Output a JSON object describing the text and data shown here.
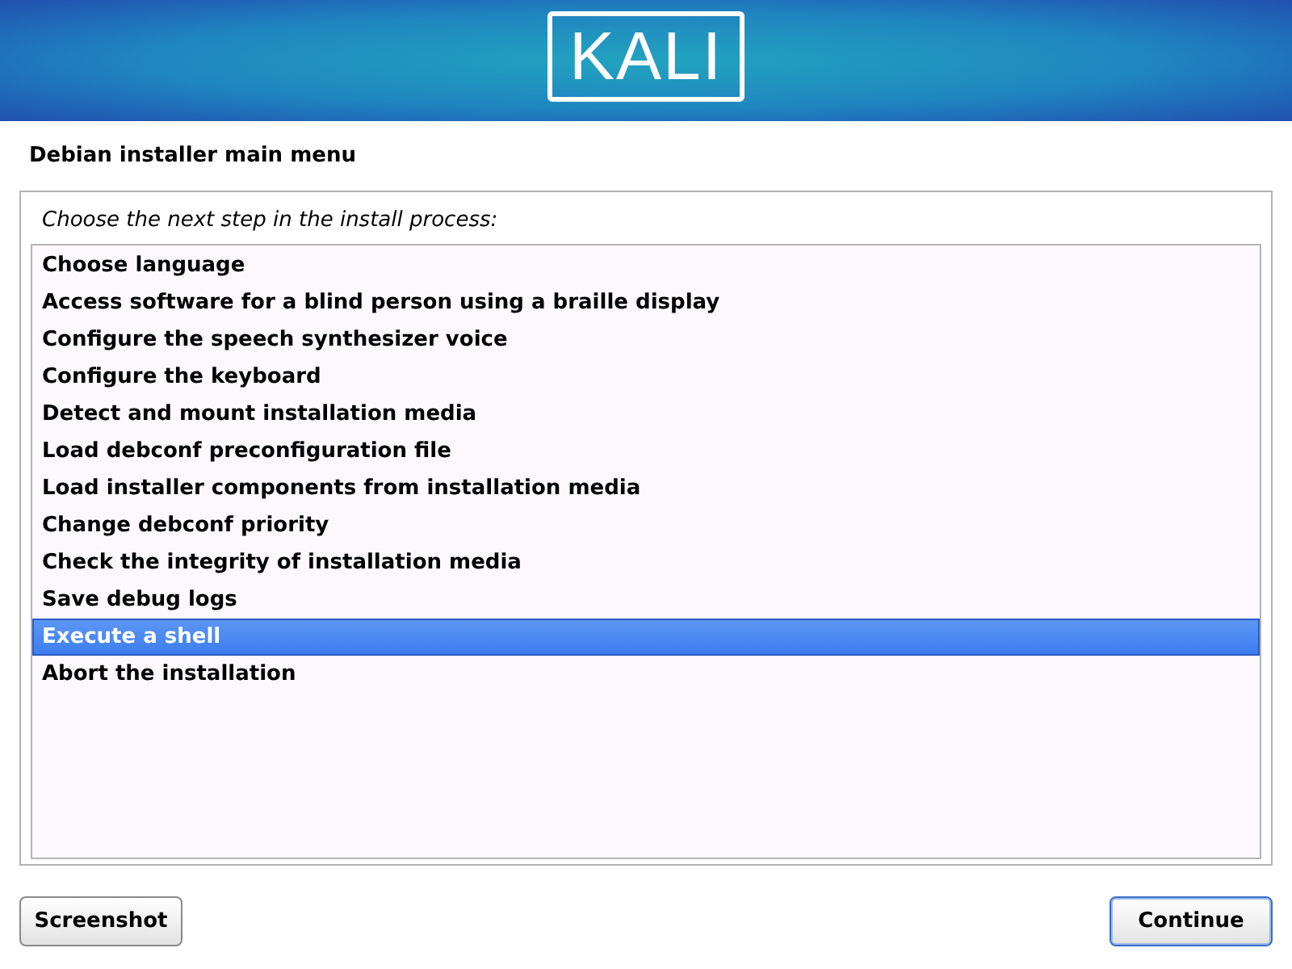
{
  "banner": {
    "logo": "KALI"
  },
  "title": "Debian installer main menu",
  "prompt": "Choose the next step in the install process:",
  "items": [
    {
      "label": "Choose language",
      "selected": false
    },
    {
      "label": "Access software for a blind person using a braille display",
      "selected": false
    },
    {
      "label": "Configure the speech synthesizer voice",
      "selected": false
    },
    {
      "label": "Configure the keyboard",
      "selected": false
    },
    {
      "label": "Detect and mount installation media",
      "selected": false
    },
    {
      "label": "Load debconf preconfiguration file",
      "selected": false
    },
    {
      "label": "Load installer components from installation media",
      "selected": false
    },
    {
      "label": "Change debconf priority",
      "selected": false
    },
    {
      "label": "Check the integrity of installation media",
      "selected": false
    },
    {
      "label": "Save debug logs",
      "selected": false
    },
    {
      "label": "Execute a shell",
      "selected": true
    },
    {
      "label": "Abort the installation",
      "selected": false
    }
  ],
  "buttons": [
    {
      "label": "Screenshot",
      "focused": false
    },
    {
      "label": "Continue",
      "focused": true
    }
  ]
}
